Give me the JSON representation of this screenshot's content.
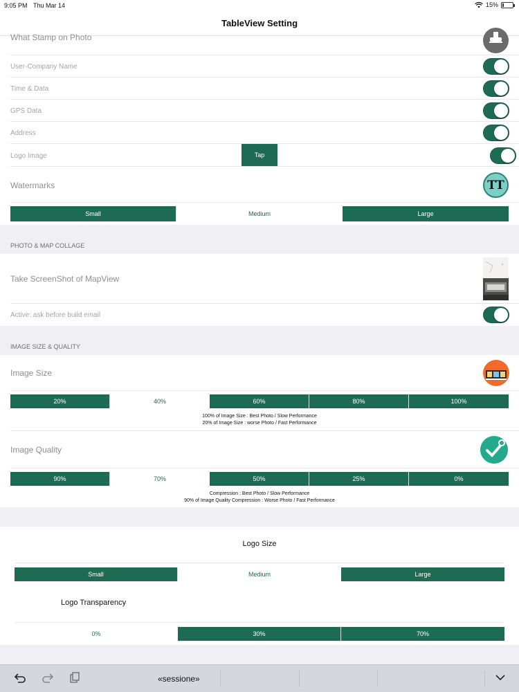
{
  "status_bar": {
    "time": "9:05 PM",
    "date": "Thu Mar 14",
    "battery": "15%",
    "battery_level": 0.15
  },
  "nav": {
    "title": "TableView Setting"
  },
  "stamp": {
    "heading": "What Stamp on Photo",
    "rows": [
      {
        "label": "User-Company Name",
        "on": true
      },
      {
        "label": "Time & Data",
        "on": true
      },
      {
        "label": "GPS Data",
        "on": true
      },
      {
        "label": "Address",
        "on": true
      },
      {
        "label": "Logo Image",
        "on": true
      }
    ],
    "tap_label": "Tap"
  },
  "watermarks": {
    "label": "Watermarks",
    "icon_text": "TT",
    "options": [
      "Small",
      "Medium",
      "Large"
    ],
    "selected": "Medium"
  },
  "collage": {
    "section_title": "PHOTO & MAP COLLAGE",
    "screenshot_label": "Take ScreenShot of MapView",
    "active_label": "Active: ask before build email",
    "active_on": true
  },
  "image": {
    "section_title": "IMAGE SIZE & QUALITY",
    "size_label": "Image Size",
    "size_options": [
      "20%",
      "40%",
      "60%",
      "80%",
      "100%"
    ],
    "size_selected": "40%",
    "size_note_1": "100% of Image Size : Best Photo / Slow Performance",
    "size_note_2": "20% of Image Size : worse Photo / Fast Performance",
    "quality_label": "Image Quality",
    "quality_options": [
      "90%",
      "70%",
      "50%",
      "25%",
      "0%"
    ],
    "quality_selected": "70%",
    "quality_note_1": "Compression : Best Photo / Slow Performance",
    "quality_note_2": "90% of Image Quality Compression  : Worse Photo / Fast Performance"
  },
  "logo": {
    "size_label": "Logo Size",
    "size_options": [
      "Small",
      "Medium",
      "Large"
    ],
    "size_selected": "Medium",
    "transparency_label": "Logo Transparency",
    "transparency_options": [
      "0%",
      "30%",
      "70%"
    ],
    "transparency_selected": "0%"
  },
  "bottom_bar": {
    "text": "«sessione»"
  },
  "colors": {
    "accent": "#1e6b53",
    "section_bg": "#efeff4"
  }
}
